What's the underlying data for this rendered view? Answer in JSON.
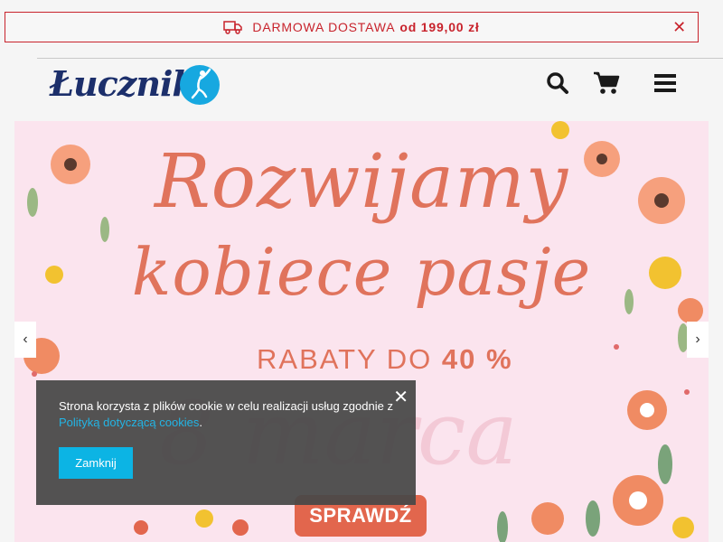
{
  "promo_bar": {
    "text": "DARMOWA DOSTAWA",
    "amount": "od 199,00 zł",
    "close_glyph": "✕"
  },
  "header": {
    "logo_text": "Łucznik",
    "icons": [
      "search-icon",
      "cart-icon",
      "menu-icon"
    ]
  },
  "banner": {
    "headline_line1": "Rozwijamy",
    "headline_line2": "kobiece pasje",
    "discount_prefix": "RABATY DO",
    "discount_value": "40 %",
    "background_script": "8 marca",
    "cta_label": "SPRAWDŹ",
    "prev_arrow": "‹",
    "next_arrow": "›"
  },
  "cookie_notice": {
    "text": "Strona korzysta z plików cookie w celu realizacji usług zgodnie z",
    "link_text": "Polityką dotyczącą cookies",
    "suffix": ".",
    "close_glyph": "✕",
    "button_label": "Zamknij"
  },
  "colors": {
    "promo_accent": "#c8232c",
    "logo_navy": "#1c2f6b",
    "logo_cyan": "#17a8e0",
    "banner_bg": "#fbe4ee",
    "headline": "#e0735c",
    "cta": "#e2664d",
    "cookie_bg": "#484848",
    "cookie_button": "#0cb4e4"
  }
}
